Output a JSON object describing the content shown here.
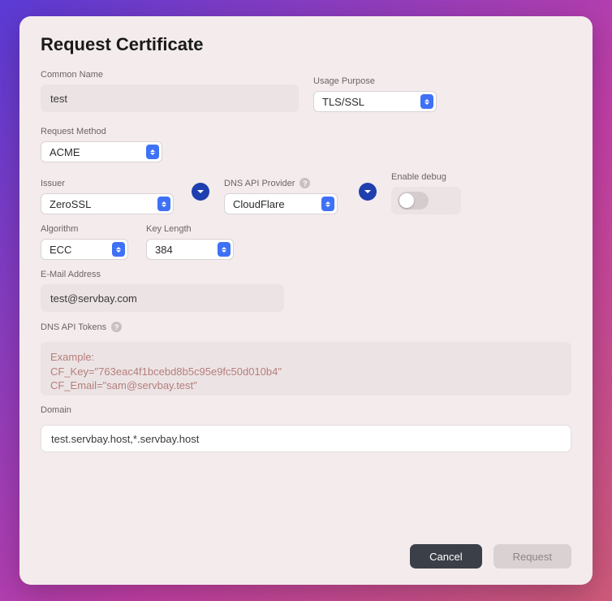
{
  "title": "Request Certificate",
  "labels": {
    "common_name": "Common Name",
    "usage_purpose": "Usage Purpose",
    "request_method": "Request Method",
    "issuer": "Issuer",
    "dns_api_provider": "DNS API Provider",
    "enable_debug": "Enable debug",
    "algorithm": "Algorithm",
    "key_length": "Key Length",
    "email": "E-Mail Address",
    "dns_api_tokens": "DNS API Tokens",
    "domain": "Domain"
  },
  "values": {
    "common_name": "test",
    "usage_purpose": "TLS/SSL",
    "request_method": "ACME",
    "issuer": "ZeroSSL",
    "dns_api_provider": "CloudFlare",
    "enable_debug": false,
    "algorithm": "ECC",
    "key_length": "384",
    "email": "test@servbay.com",
    "dns_api_tokens": "",
    "domain": "test.servbay.host,*.servbay.host"
  },
  "placeholders": {
    "dns_api_tokens": "Example:\nCF_Key=\"763eac4f1bcebd8b5c95e9fc50d010b4\"\nCF_Email=\"sam@servbay.test\""
  },
  "buttons": {
    "cancel": "Cancel",
    "request": "Request"
  },
  "help_glyph": "?"
}
